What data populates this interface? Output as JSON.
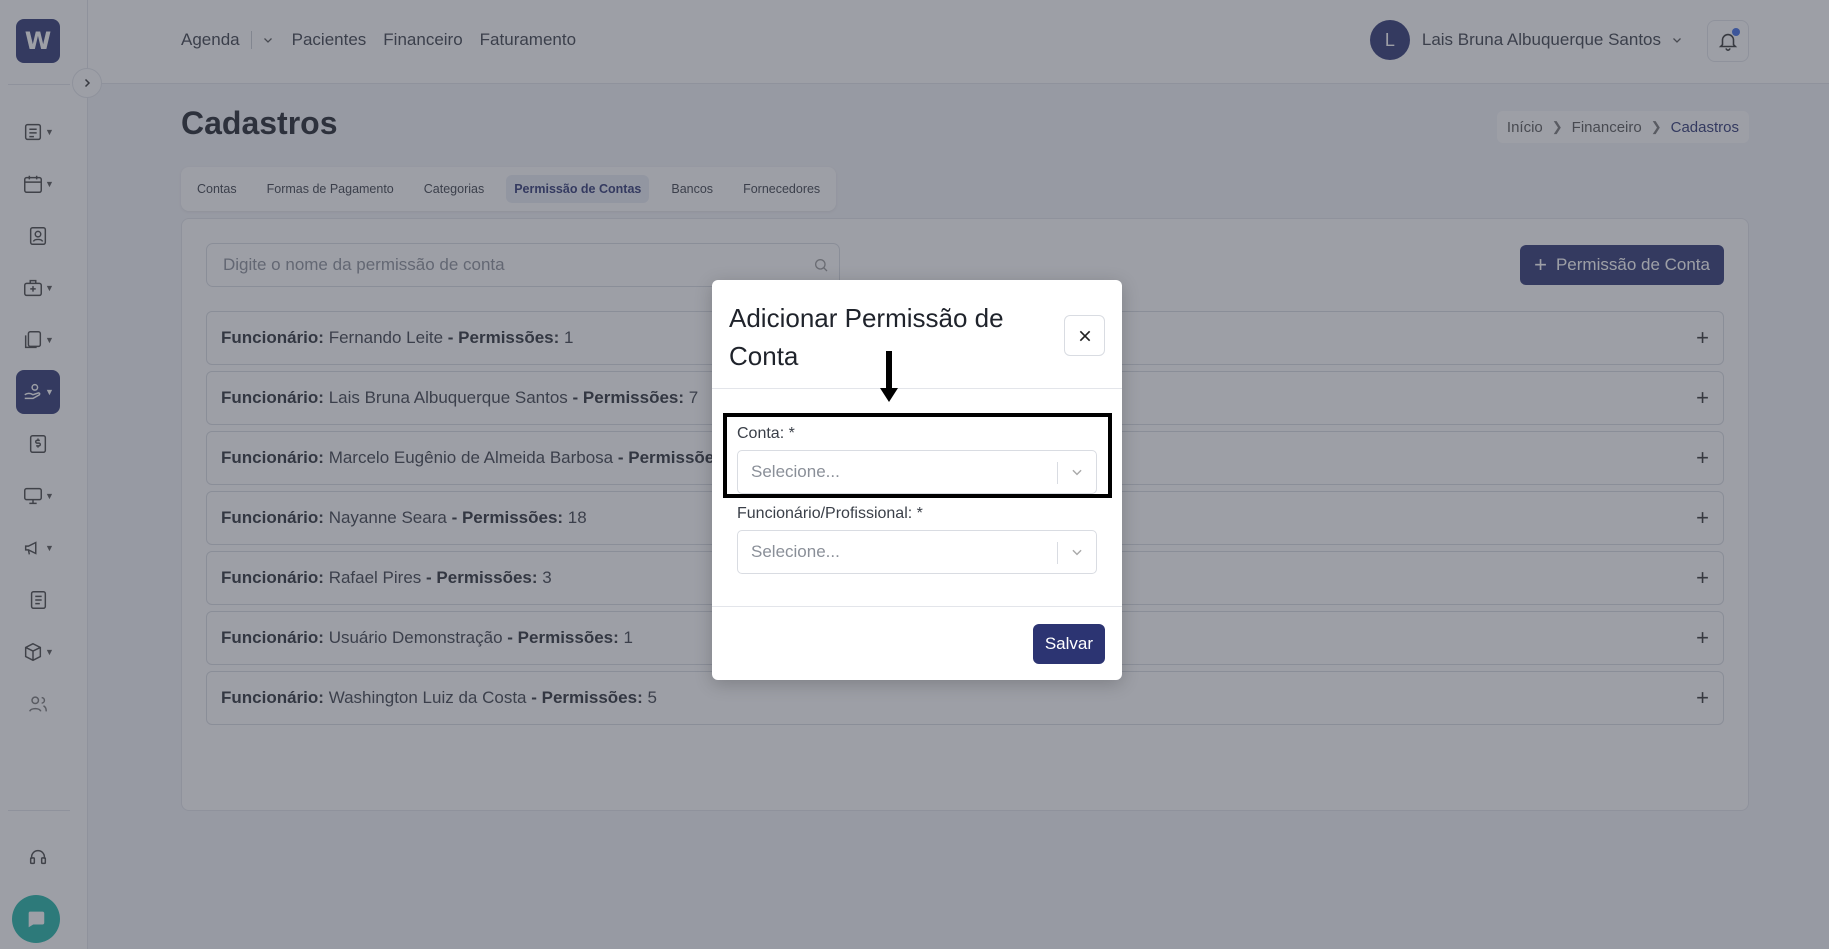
{
  "sidebar": {
    "logo": "W",
    "items": [
      {
        "icon": "list-icon",
        "active": false
      },
      {
        "icon": "calendar-icon",
        "active": false
      },
      {
        "icon": "id-card-icon",
        "active": false
      },
      {
        "icon": "medical-bag-icon",
        "active": false
      },
      {
        "icon": "documents-icon",
        "active": false
      },
      {
        "icon": "hand-money-icon",
        "active": true
      },
      {
        "icon": "dollar-document-icon",
        "active": false
      },
      {
        "icon": "monitor-icon",
        "active": false
      },
      {
        "icon": "megaphone-icon",
        "active": false
      },
      {
        "icon": "report-icon",
        "active": false
      },
      {
        "icon": "box-icon",
        "active": false
      },
      {
        "icon": "users-icon",
        "active": false
      }
    ],
    "support_icon": "headset-icon",
    "chat_icon": "chat-icon"
  },
  "topnav": {
    "items": [
      "Agenda",
      "Pacientes",
      "Financeiro",
      "Faturamento"
    ]
  },
  "user": {
    "initial": "L",
    "name": "Lais Bruna Albuquerque Santos"
  },
  "page": {
    "title": "Cadastros",
    "breadcrumb": [
      "Início",
      "Financeiro",
      "Cadastros"
    ]
  },
  "tabs": [
    {
      "label": "Contas",
      "active": false
    },
    {
      "label": "Formas de Pagamento",
      "active": false
    },
    {
      "label": "Categorias",
      "active": false
    },
    {
      "label": "Permissão de Contas",
      "active": true
    },
    {
      "label": "Bancos",
      "active": false
    },
    {
      "label": "Fornecedores",
      "active": false
    }
  ],
  "search": {
    "placeholder": "Digite o nome da permissão de conta"
  },
  "add_button": "Permissão de Conta",
  "rows_labels": {
    "employee": "Funcionário:",
    "permissions": "- Permissões:"
  },
  "rows": [
    {
      "name": "Fernando Leite",
      "count": "1"
    },
    {
      "name": "Lais Bruna Albuquerque Santos",
      "count": "7"
    },
    {
      "name": "Marcelo Eugênio de Almeida Barbosa",
      "count": ""
    },
    {
      "name": "Nayanne Seara",
      "count": "18"
    },
    {
      "name": "Rafael Pires",
      "count": "3"
    },
    {
      "name": "Usuário Demonstração",
      "count": "1"
    },
    {
      "name": "Washington Luiz da Costa",
      "count": "5"
    }
  ],
  "modal": {
    "title": "Adicionar Permissão de Conta",
    "fields": [
      {
        "label": "Conta: *",
        "placeholder": "Selecione..."
      },
      {
        "label": "Funcionário/Profissional: *",
        "placeholder": "Selecione..."
      }
    ],
    "save_label": "Salvar"
  },
  "colors": {
    "brand": "#2c3472",
    "chat": "#1fb5a6",
    "notification_dot": "#3f6de6"
  }
}
